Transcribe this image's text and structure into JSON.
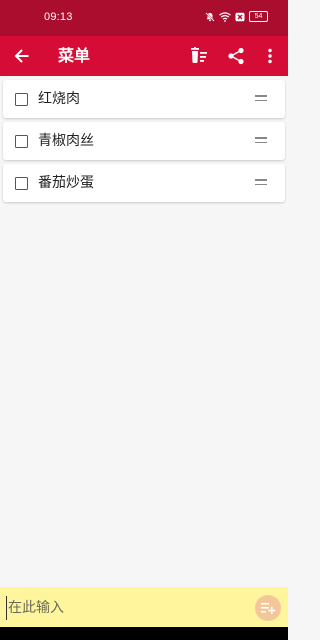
{
  "status_bar": {
    "time": "09:13",
    "battery": "54",
    "icons": [
      "mute-icon",
      "wifi-icon",
      "sim-x-icon",
      "battery-icon"
    ]
  },
  "app_bar": {
    "title": "菜单",
    "actions": [
      "delete-checked-icon",
      "share-icon",
      "more-vert-icon"
    ]
  },
  "items": [
    {
      "label": "红烧肉",
      "checked": false
    },
    {
      "label": "青椒肉丝",
      "checked": false
    },
    {
      "label": "番茄炒蛋",
      "checked": false
    }
  ],
  "input": {
    "placeholder": "在此输入",
    "value": ""
  },
  "colors": {
    "status_bar": "#ab0d2e",
    "app_bar": "#d40c36",
    "input_bar": "#fff59d",
    "add_button": "#f4c79a",
    "background": "#f6f6f6"
  }
}
